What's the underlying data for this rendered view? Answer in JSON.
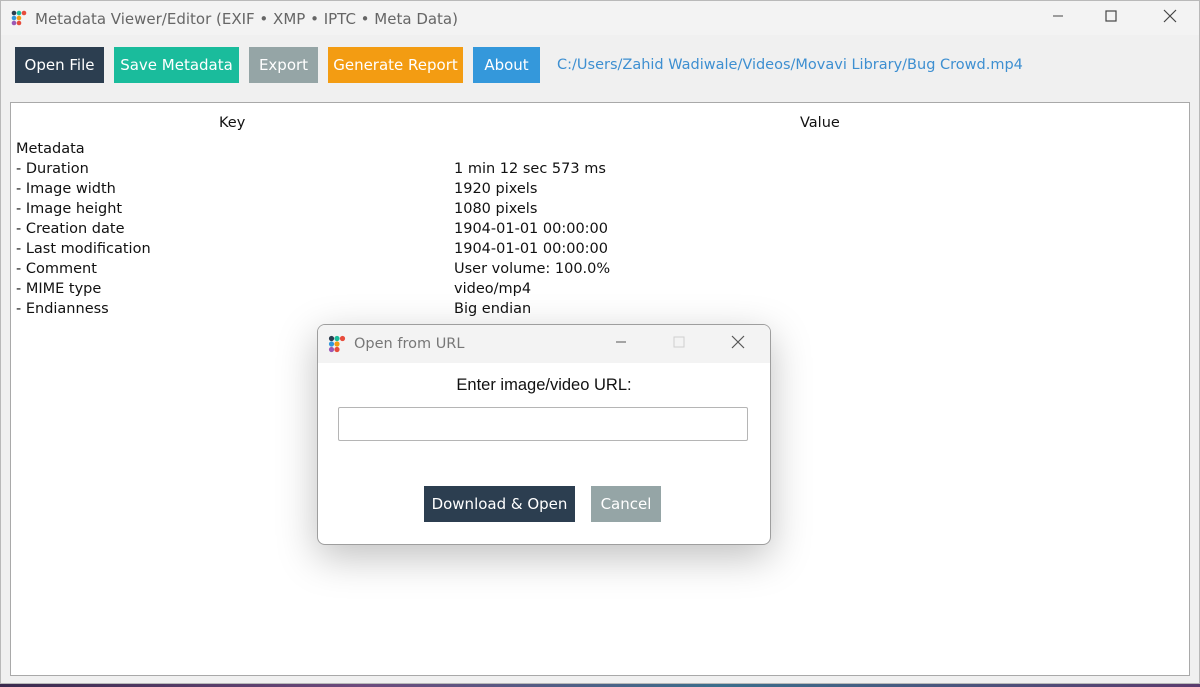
{
  "window": {
    "title": "Metadata Viewer/Editor (EXIF • XMP • IPTC • Meta Data)"
  },
  "toolbar": {
    "open_file": "Open File",
    "save_metadata": "Save Metadata",
    "export": "Export",
    "generate_report": "Generate Report",
    "about": "About",
    "file_path": "C:/Users/Zahid Wadiwale/Videos/Movavi Library/Bug Crowd.mp4"
  },
  "colors": {
    "open_file": "#2c3e50",
    "save_metadata": "#1abc9c",
    "export": "#95a5a6",
    "generate_report": "#f39c12",
    "about": "#3498db",
    "path_link": "#3d8fd1"
  },
  "table": {
    "headers": {
      "key": "Key",
      "value": "Value"
    },
    "rows": [
      {
        "key": "Metadata",
        "value": ""
      },
      {
        "key": "- Duration",
        "value": "1 min 12 sec 573 ms"
      },
      {
        "key": "- Image width",
        "value": "1920 pixels"
      },
      {
        "key": "- Image height",
        "value": "1080 pixels"
      },
      {
        "key": "- Creation date",
        "value": "1904-01-01 00:00:00"
      },
      {
        "key": "- Last modification",
        "value": "1904-01-01 00:00:00"
      },
      {
        "key": "- Comment",
        "value": "User volume: 100.0%"
      },
      {
        "key": "- MIME type",
        "value": "video/mp4"
      },
      {
        "key": "- Endianness",
        "value": "Big endian"
      }
    ]
  },
  "dialog": {
    "title": "Open from URL",
    "label": "Enter image/video URL:",
    "input_value": "",
    "download_open": "Download & Open",
    "cancel": "Cancel"
  },
  "icons": {
    "app": "app-dots-icon",
    "minimize": "minimize-icon",
    "maximize": "maximize-icon",
    "close": "close-icon"
  }
}
